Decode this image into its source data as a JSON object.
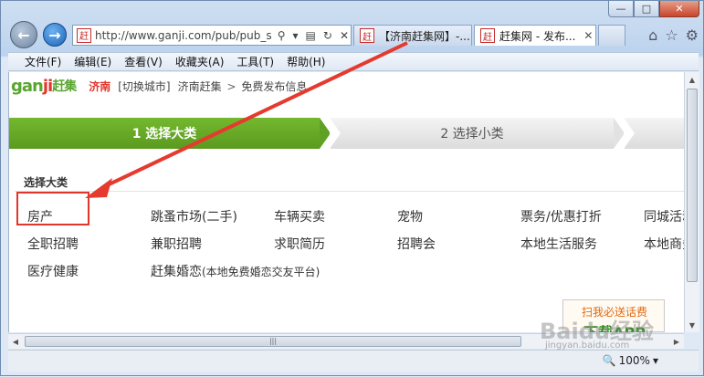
{
  "browser": {
    "address_url": "http://www.ganji.com/pub/pub_se",
    "address_favicon": "赶",
    "tabs": [
      {
        "favicon": "赶",
        "label": "【济南赶集网】-...",
        "active": false
      },
      {
        "favicon": "赶",
        "label": "赶集网 - 发布...",
        "active": true
      }
    ],
    "menu": [
      "文件(F)",
      "编辑(E)",
      "查看(V)",
      "收藏夹(A)",
      "工具(T)",
      "帮助(H)"
    ],
    "zoom": "100%",
    "icons": {
      "back": "back-arrow-icon",
      "forward": "forward-arrow-icon",
      "search": "search-icon",
      "refresh": "refresh-icon",
      "stop": "stop-icon",
      "home": "home-icon",
      "favorites": "star-icon",
      "tools": "gear-icon"
    }
  },
  "site": {
    "logo_main": "gan",
    "logo_mid": "ji",
    "logo_cn": "赶集",
    "city": "济南",
    "switch_city": "[切换城市]",
    "crumb_home": "济南赶集",
    "crumb_sep": ">",
    "crumb_current": "免费发布信息"
  },
  "steps": {
    "step1": "1 选择大类",
    "step2": "2 选择小类"
  },
  "section": {
    "title": "选择大类",
    "row1": [
      "房产",
      "跳蚤市场(二手)",
      "车辆买卖",
      "宠物",
      "票务/优惠打折",
      "同城活动"
    ],
    "row2": [
      "全职招聘",
      "兼职招聘",
      "求职简历",
      "招聘会",
      "本地生活服务",
      "本地商务"
    ],
    "row3_a": "医疗健康",
    "row3_b": "赶集婚恋",
    "row3_b_note": "(本地免费婚恋交友平台)"
  },
  "ad": {
    "line1": "扫我必送话费",
    "line2": "下载APP"
  },
  "watermark": {
    "main": "Baidu经验",
    "sub": "jingyan.baidu.com"
  },
  "colors": {
    "brand_green": "#5aa52f",
    "brand_red": "#e0362c",
    "highlight_red": "#e0362c"
  }
}
